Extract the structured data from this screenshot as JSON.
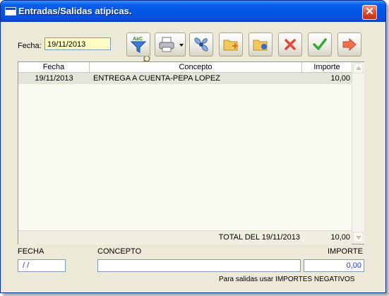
{
  "window": {
    "title": "Entradas/Salidas atípicas."
  },
  "filter": {
    "label": "Fecha:",
    "date": "19/11/2013"
  },
  "toolbar": {
    "buttons": [
      {
        "name": "filter",
        "icon": "funnel-abc-icon"
      },
      {
        "name": "print",
        "icon": "printer-icon"
      },
      {
        "name": "tools",
        "icon": "propeller-icon"
      },
      {
        "name": "new",
        "icon": "folder-add-icon"
      },
      {
        "name": "edit",
        "icon": "folder-edit-icon"
      },
      {
        "name": "delete",
        "icon": "red-x-icon"
      },
      {
        "name": "accept",
        "icon": "green-check-icon"
      },
      {
        "name": "exit",
        "icon": "red-arrow-exit-icon"
      }
    ]
  },
  "grid": {
    "columns": [
      "Fecha",
      "Concepto",
      "Importe"
    ],
    "rows": [
      {
        "fecha": "19/11/2013",
        "concepto": "ENTREGA A CUENTA-PEPA LOPEZ",
        "importe": "10,00"
      }
    ],
    "total_label": "TOTAL DEL 19/11/2013",
    "total_value": "10,00"
  },
  "form": {
    "fecha_label": "FECHA",
    "fecha_value": " / /",
    "concepto_label": "CONCEPTO",
    "concepto_value": "",
    "importe_label": "IMPORTE",
    "importe_value": "0,00"
  },
  "note": "Para salidas usar IMPORTES NEGATIVOS",
  "colors": {
    "titlebar": "#0055e5",
    "date_field": "#ffffc4",
    "row_selected": "#e4e4d8",
    "importe_value": "#1a3fd0"
  }
}
